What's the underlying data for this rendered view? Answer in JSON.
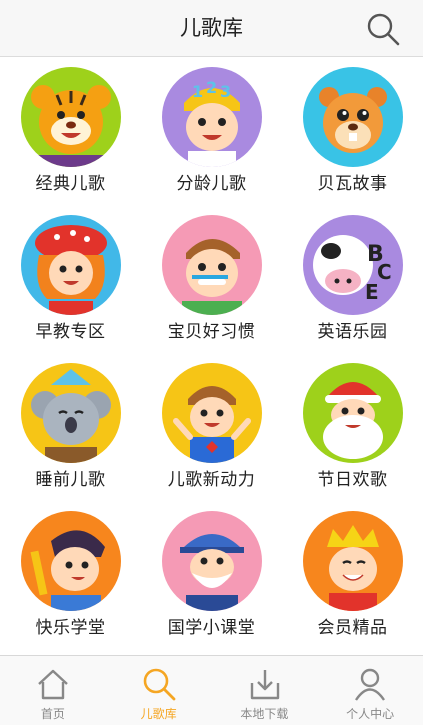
{
  "header": {
    "title": "儿歌库",
    "search_icon": "search-icon"
  },
  "categories": [
    {
      "label": "经典儿歌",
      "bg": "#9ed11b",
      "icon": "tiger-icon"
    },
    {
      "label": "分龄儿歌",
      "bg": "#a98ae0",
      "icon": "kid-123-icon"
    },
    {
      "label": "贝瓦故事",
      "bg": "#39c3e6",
      "icon": "beaver-icon"
    },
    {
      "label": "早教专区",
      "bg": "#41b8e8",
      "icon": "girl-mushroom-hat-icon"
    },
    {
      "label": "宝贝好习惯",
      "bg": "#f59ab5",
      "icon": "boy-toothbrush-icon"
    },
    {
      "label": "英语乐园",
      "bg": "#a98ae0",
      "icon": "cow-abc-icon"
    },
    {
      "label": "睡前儿歌",
      "bg": "#f6c516",
      "icon": "koala-icon"
    },
    {
      "label": "儿歌新动力",
      "bg": "#f6c516",
      "icon": "superhero-boy-icon"
    },
    {
      "label": "节日欢歌",
      "bg": "#9ed11b",
      "icon": "santa-icon"
    },
    {
      "label": "快乐学堂",
      "bg": "#f7861d",
      "icon": "boy-pencil-icon"
    },
    {
      "label": "国学小课堂",
      "bg": "#f59ab5",
      "icon": "old-scholar-icon"
    },
    {
      "label": "会员精品",
      "bg": "#f7861d",
      "icon": "king-crown-icon"
    }
  ],
  "tabs": [
    {
      "label": "首页",
      "icon": "home-icon",
      "active": false
    },
    {
      "label": "儿歌库",
      "icon": "search-icon",
      "active": true
    },
    {
      "label": "本地下载",
      "icon": "download-icon",
      "active": false
    },
    {
      "label": "个人中心",
      "icon": "user-icon",
      "active": false
    }
  ],
  "colors": {
    "accent": "#f5a623",
    "tab_inactive": "#888888",
    "header_bg": "#f7f7f7"
  }
}
